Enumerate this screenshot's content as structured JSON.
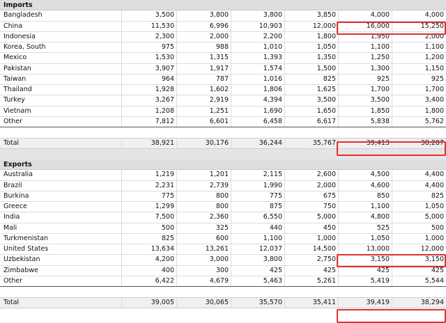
{
  "imports": {
    "heading": "Imports",
    "rows": [
      {
        "country": "Bangladesh",
        "v": [
          "3,500",
          "3,800",
          "3,800",
          "3,850",
          "4,000",
          "4,000"
        ]
      },
      {
        "country": "China",
        "v": [
          "11,530",
          "6,996",
          "10,903",
          "12,000",
          "16,000",
          "15,250"
        ]
      },
      {
        "country": "Indonesia",
        "v": [
          "2,300",
          "2,000",
          "2,200",
          "1,800",
          "1,950",
          "2,000"
        ]
      },
      {
        "country": "Korea, South",
        "v": [
          "975",
          "988",
          "1,010",
          "1,050",
          "1,100",
          "1,100"
        ]
      },
      {
        "country": "Mexico",
        "v": [
          "1,530",
          "1,315",
          "1,393",
          "1,350",
          "1,250",
          "1,200"
        ]
      },
      {
        "country": "Pakistan",
        "v": [
          "3,907",
          "1,917",
          "1,574",
          "1,500",
          "1,300",
          "1,150"
        ]
      },
      {
        "country": "Taiwan",
        "v": [
          "964",
          "787",
          "1,016",
          "825",
          "925",
          "925"
        ]
      },
      {
        "country": "Thailand",
        "v": [
          "1,928",
          "1,602",
          "1,806",
          "1,625",
          "1,700",
          "1,700"
        ]
      },
      {
        "country": "Turkey",
        "v": [
          "3,267",
          "2,919",
          "4,394",
          "3,500",
          "3,500",
          "3,400"
        ]
      },
      {
        "country": "Vietnam",
        "v": [
          "1,208",
          "1,251",
          "1,690",
          "1,650",
          "1,850",
          "1,800"
        ]
      },
      {
        "country": "Other",
        "v": [
          "7,812",
          "6,601",
          "6,458",
          "6,617",
          "5,838",
          "5,762"
        ]
      }
    ],
    "total": {
      "label": "Total",
      "v": [
        "38,921",
        "30,176",
        "36,244",
        "35,767",
        "39,413",
        "38,287"
      ]
    }
  },
  "exports": {
    "heading": "Exports",
    "rows": [
      {
        "country": "Australia",
        "v": [
          "1,219",
          "1,201",
          "2,115",
          "2,600",
          "4,500",
          "4,400"
        ]
      },
      {
        "country": "Brazil",
        "v": [
          "2,231",
          "2,739",
          "1,990",
          "2,000",
          "4,600",
          "4,400"
        ]
      },
      {
        "country": "Burkina",
        "v": [
          "775",
          "800",
          "775",
          "675",
          "850",
          "825"
        ]
      },
      {
        "country": "Greece",
        "v": [
          "1,299",
          "800",
          "875",
          "750",
          "1,100",
          "1,050"
        ]
      },
      {
        "country": "India",
        "v": [
          "7,500",
          "2,360",
          "6,550",
          "5,000",
          "4,800",
          "5,000"
        ]
      },
      {
        "country": "Mali",
        "v": [
          "500",
          "325",
          "440",
          "450",
          "525",
          "500"
        ]
      },
      {
        "country": "Turkmenistan",
        "v": [
          "825",
          "600",
          "1,100",
          "1,000",
          "1,050",
          "1,000"
        ]
      },
      {
        "country": "United States",
        "v": [
          "13,634",
          "13,261",
          "12,037",
          "14,500",
          "13,000",
          "12,000"
        ]
      },
      {
        "country": "Uzbekistan",
        "v": [
          "4,200",
          "3,000",
          "3,800",
          "2,750",
          "3,150",
          "3,150"
        ]
      },
      {
        "country": "Zimbabwe",
        "v": [
          "400",
          "300",
          "425",
          "425",
          "425",
          "425"
        ]
      },
      {
        "country": "Other",
        "v": [
          "6,422",
          "4,679",
          "5,463",
          "5,261",
          "5,419",
          "5,544"
        ]
      }
    ],
    "total": {
      "label": "Total",
      "v": [
        "39,005",
        "30,065",
        "35,570",
        "35,411",
        "39,419",
        "38,294"
      ]
    }
  },
  "highlight_color": "#e03030"
}
